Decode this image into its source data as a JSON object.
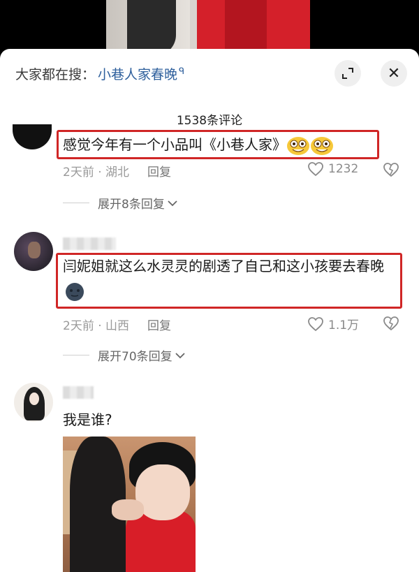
{
  "search": {
    "prefix": "大家都在搜：",
    "link": "小巷人家春晚",
    "glyph": "ᑫ"
  },
  "header": {
    "expand_icon": "fullscreen-icon",
    "close_glyph": "✕"
  },
  "comment_count": "1538条评论",
  "comments": [
    {
      "text": "感觉今年有一个小品叫《小巷人家》",
      "meta_time": "2天前 · 湖北",
      "reply_label": "回复",
      "likes": "1232",
      "expand_label": "展开8条回复",
      "emoji": [
        "grin-emoji",
        "grin-emoji"
      ]
    },
    {
      "text": "闫妮姐就这么水灵灵的剧透了自己和这小孩要去春晚",
      "meta_time": "2天前 · 山西",
      "reply_label": "回复",
      "likes": "1.1万",
      "expand_label": "展开70条回复",
      "emoji": [
        "dark-face-emoji"
      ]
    },
    {
      "text": "我是谁?"
    }
  ],
  "colors": {
    "highlight": "#d02626",
    "link": "#2e5f9c"
  }
}
